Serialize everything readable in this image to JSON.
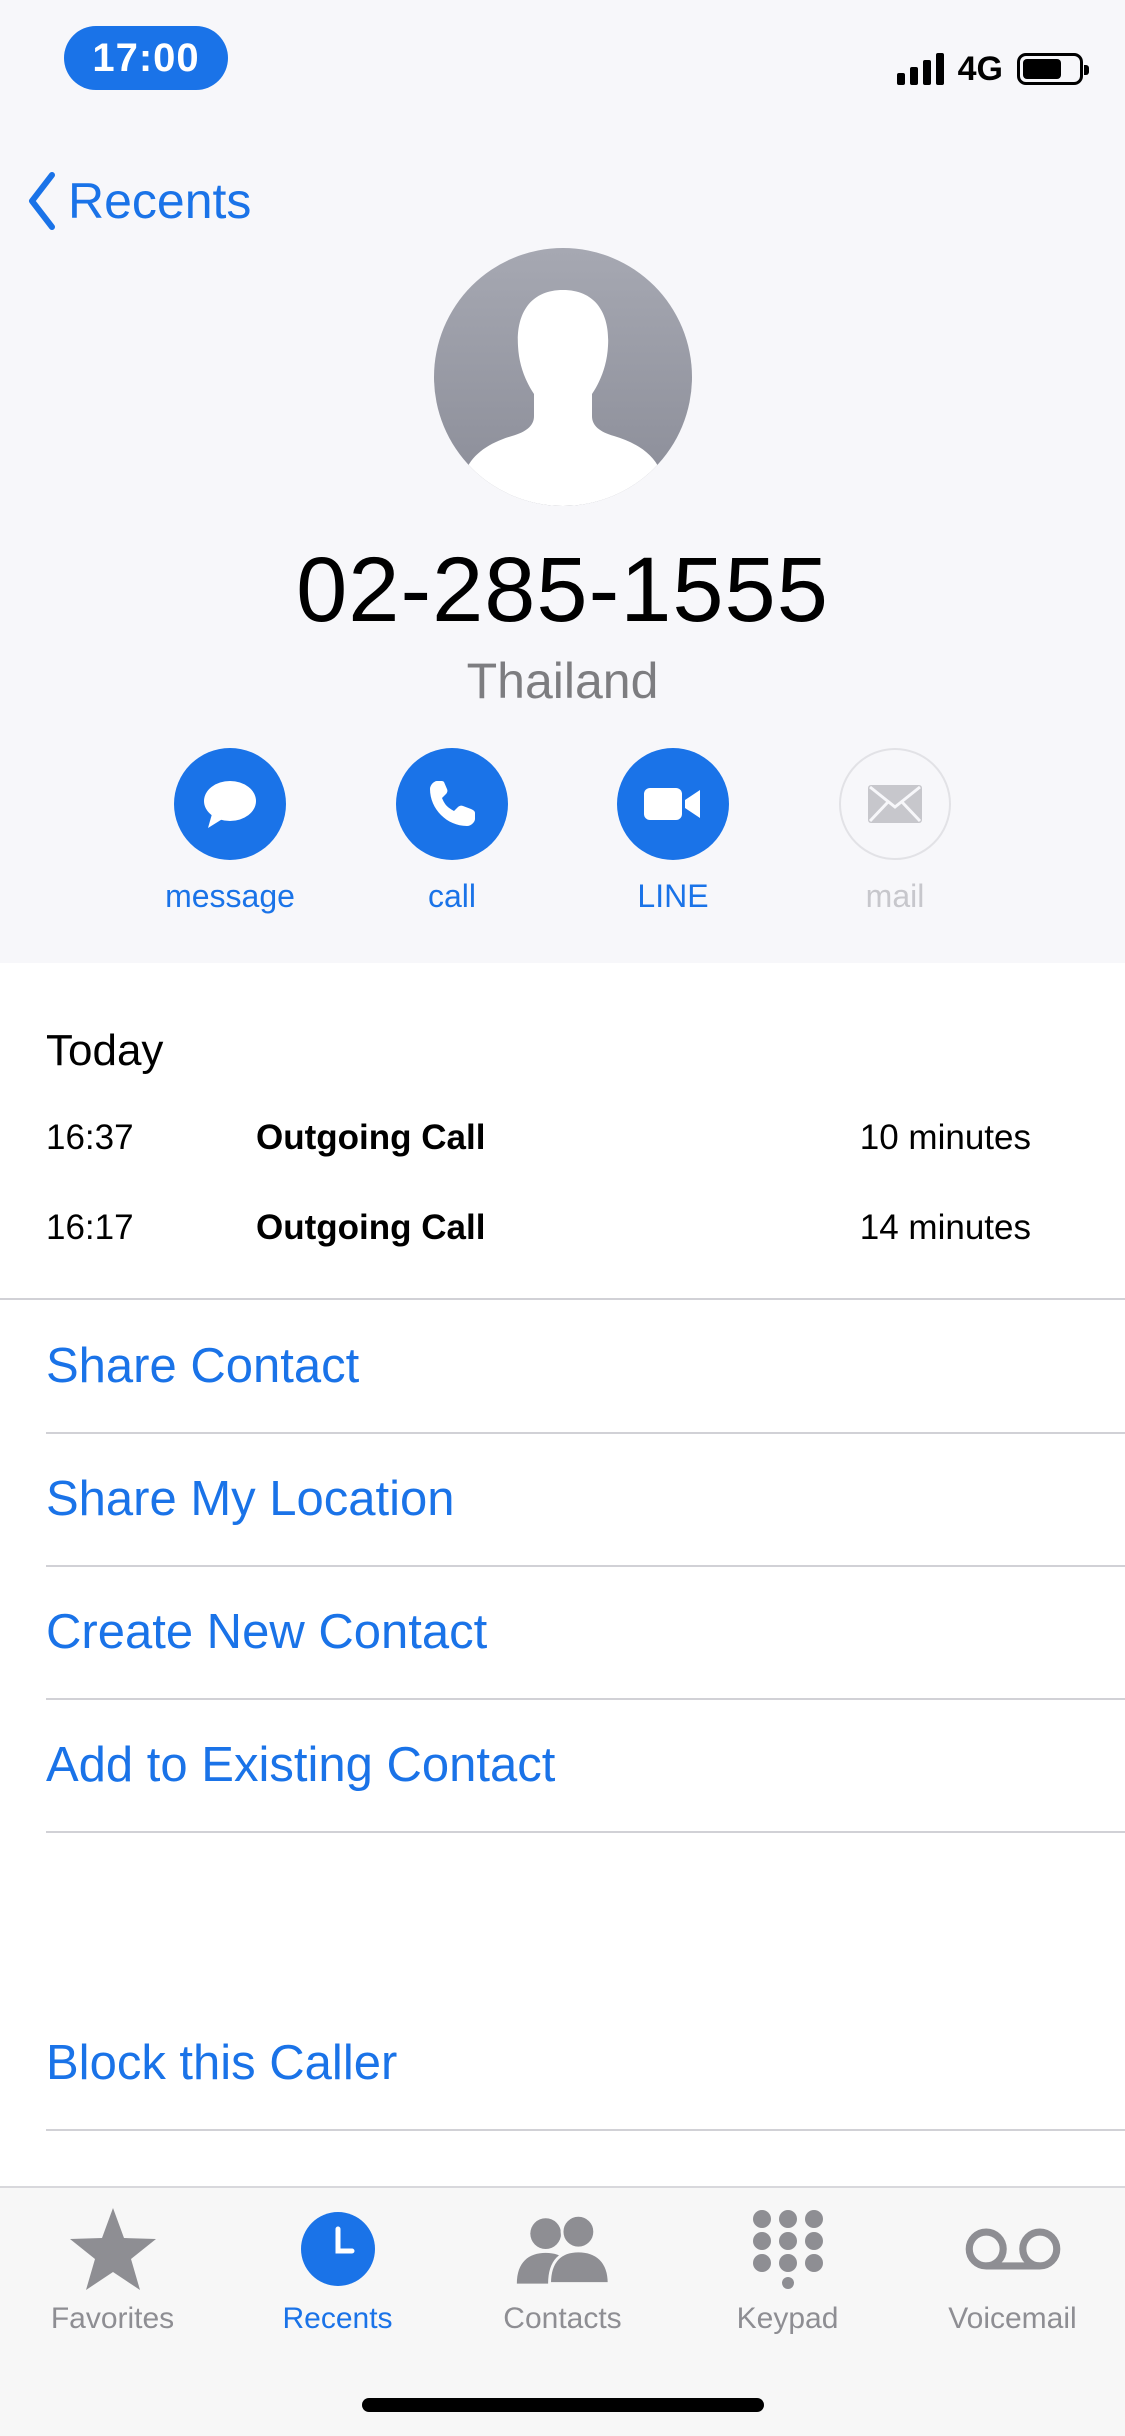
{
  "status_bar": {
    "time": "17:00",
    "network": "4G"
  },
  "nav": {
    "back_label": "Recents"
  },
  "contact": {
    "phone_number": "02-285-1555",
    "country": "Thailand"
  },
  "actions": [
    {
      "label": "message",
      "icon": "message-bubble-icon",
      "enabled": true
    },
    {
      "label": "call",
      "icon": "phone-icon",
      "enabled": true
    },
    {
      "label": "LINE",
      "icon": "video-camera-icon",
      "enabled": true
    },
    {
      "label": "mail",
      "icon": "envelope-icon",
      "enabled": false
    }
  ],
  "recents": {
    "day_label": "Today",
    "calls": [
      {
        "time": "16:37",
        "type": "Outgoing Call",
        "duration": "10 minutes"
      },
      {
        "time": "16:17",
        "type": "Outgoing Call",
        "duration": "14 minutes"
      }
    ]
  },
  "options": [
    "Share Contact",
    "Share My Location",
    "Create New Contact",
    "Add to Existing Contact"
  ],
  "block_label": "Block this Caller",
  "tabs": [
    {
      "label": "Favorites",
      "icon": "star-icon"
    },
    {
      "label": "Recents",
      "icon": "clock-icon",
      "active": true
    },
    {
      "label": "Contacts",
      "icon": "people-icon"
    },
    {
      "label": "Keypad",
      "icon": "keypad-icon"
    },
    {
      "label": "Voicemail",
      "icon": "voicemail-icon"
    }
  ],
  "colors": {
    "accent": "#1a73e8",
    "header_bg": "#f7f7fa",
    "secondary_text": "#7d7d80",
    "tab_inactive": "#8e8e93"
  }
}
